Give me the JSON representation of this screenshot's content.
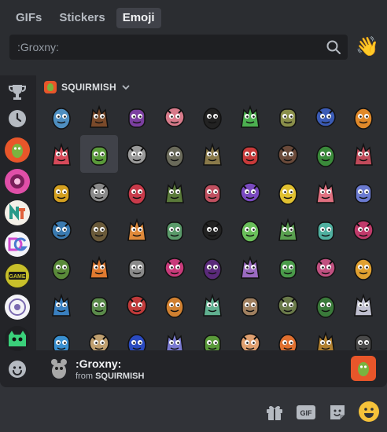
{
  "tabs": [
    {
      "label": "GIFs",
      "active": false
    },
    {
      "label": "Stickers",
      "active": false
    },
    {
      "label": "Emoji",
      "active": true
    }
  ],
  "search": {
    "placeholder": ":Groxny:",
    "icon": "search-icon"
  },
  "random_emoji_button": {
    "icon": "waving-hand-icon"
  },
  "sidebar": [
    {
      "icon": "trophy-icon"
    },
    {
      "icon": "clock-icon"
    },
    {
      "icon": "server-squirmish",
      "active": true
    },
    {
      "icon": "server-pink"
    },
    {
      "icon": "server-nt"
    },
    {
      "icon": "server-dg"
    },
    {
      "icon": "server-game"
    },
    {
      "icon": "server-circle"
    },
    {
      "icon": "server-green-monster"
    },
    {
      "icon": "smiley-icon"
    }
  ],
  "category": {
    "name": "SQUIRMISH",
    "icon": "chevron-down-icon"
  },
  "grid": {
    "columns": 9,
    "rows": 7,
    "selected_index": 10,
    "palette": [
      "#4f8fc0",
      "#7a4a2a",
      "#7b3fa0",
      "#d77a8a",
      "#222",
      "#4caf50",
      "#8a8f4a",
      "#3b5bb5",
      "#e0892a",
      "#d64a5a",
      "#5a9a3a",
      "#9a9a9a",
      "#6a6a5a",
      "#8a7a4a",
      "#c83a3a",
      "#6a4a3a",
      "#3a8a3a",
      "#c04a5a",
      "#d4a020",
      "#8a8a8a",
      "#c83a4a",
      "#5a7a3a",
      "#c05060",
      "#7a4ac0",
      "#e0c030",
      "#e07080",
      "#6a7ad0",
      "#3a7ab0",
      "#6a5a3a",
      "#e08a3a",
      "#5a9a6a",
      "#222",
      "#6abf5a",
      "#5aa050",
      "#50b0a0",
      "#c03a6a",
      "#5a8a3a",
      "#e07a30",
      "#8a8a8a",
      "#c83a7a",
      "#5a2a7a",
      "#9a6ac0",
      "#4a9a4a",
      "#c05080",
      "#e0a030",
      "#3a80c0",
      "#5a8a4a",
      "#c03a3a",
      "#d08030",
      "#60b090",
      "#a08060",
      "#6a7a4a",
      "#3a7a3a",
      "#c0c0d0",
      "#3a90d0",
      "#c0a070",
      "#2a4ac0",
      "#7a7ad0",
      "#5a9a3a",
      "#e0a070",
      "#e07030",
      "#b08030",
      "#4a4a4a"
    ]
  },
  "footer": {
    "name": ":Groxny:",
    "from_prefix": "from",
    "server": "SQUIRMISH"
  },
  "input_bar": [
    {
      "icon": "gift-icon"
    },
    {
      "icon": "gif-icon",
      "label": "GIF"
    },
    {
      "icon": "sticker-icon"
    },
    {
      "icon": "emoji-smiley-icon"
    }
  ]
}
